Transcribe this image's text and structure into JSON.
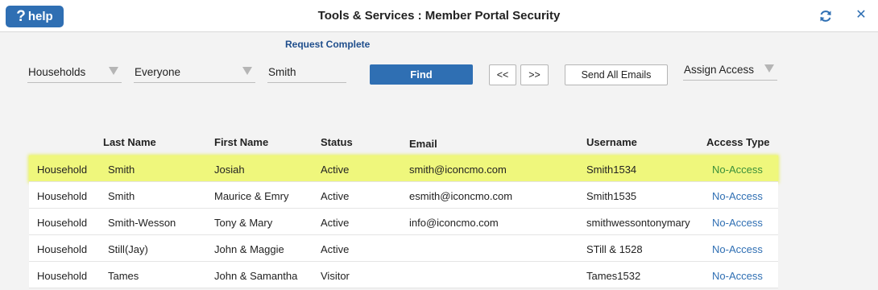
{
  "titlebar": {
    "help_label": "help",
    "help_glyph": "?",
    "title": "Tools & Services : Member Portal Security",
    "refresh_icon": "refresh-icon",
    "close_icon": "close-icon",
    "close_glyph": "✕"
  },
  "status_message": "Request Complete",
  "filters": {
    "type": "Households",
    "audience": "Everyone",
    "search_value": "Smith",
    "find_label": "Find",
    "prev_label": "<<",
    "next_label": ">>",
    "send_all_label": "Send All Emails",
    "assign_access": "Assign Access"
  },
  "table": {
    "headers": {
      "last_name": "Last Name",
      "first_name": "First Name",
      "status": "Status",
      "email": "Email",
      "username": "Username",
      "access_type": "Access Type"
    },
    "rows": [
      {
        "type": "Household",
        "last": "Smith",
        "first": "Josiah",
        "status": "Active",
        "email": "smith@iconcmo.com",
        "username": "Smith1534",
        "access": "No-Access"
      },
      {
        "type": "Household",
        "last": "Smith",
        "first": "Maurice & Emry",
        "status": "Active",
        "email": "esmith@iconcmo.com",
        "username": "Smith1535",
        "access": "No-Access"
      },
      {
        "type": "Household",
        "last": "Smith-Wesson",
        "first": "Tony & Mary",
        "status": "Active",
        "email": "info@iconcmo.com",
        "username": "smithwessontonymary",
        "access": "No-Access"
      },
      {
        "type": "Household",
        "last": "Still(Jay)",
        "first": "John & Maggie",
        "status": "Active",
        "email": "",
        "username": "STill & 1528",
        "access": "No-Access"
      },
      {
        "type": "Household",
        "last": "Tames",
        "first": "John & Samantha",
        "status": "Visitor",
        "email": "",
        "username": "Tames1532",
        "access": "No-Access"
      }
    ]
  },
  "colors": {
    "accent": "#2f6fb3",
    "highlight_row": "#eff77c",
    "background": "#f3f3f3"
  }
}
